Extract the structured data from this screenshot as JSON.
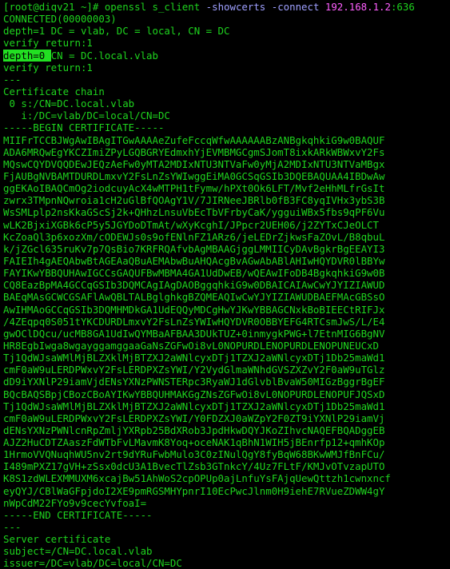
{
  "terminal": {
    "colors": {
      "background": "#000000",
      "text": "#1ed41e",
      "option_flag": "#9fa0ff",
      "ip_address": "#ff5fff",
      "selection_bg": "#22e022",
      "selection_fg": "#000000"
    },
    "prompt": "[root@diqv21 ~]# ",
    "command": {
      "program": "openssl s_client ",
      "flag1": "-showcerts",
      "space": " ",
      "flag2": "-connect",
      "space2": " ",
      "ip": "192.168.1.2",
      "port": ":636"
    },
    "before_cert": [
      "CONNECTED(00000003)",
      "depth=1 DC = vlab, DC = local, CN = DC",
      "verify return:1"
    ],
    "highlight_line": {
      "selected": "depth=0 ",
      "rest": "CN = DC.local.vlab"
    },
    "after_highlight": [
      "verify return:1",
      "---",
      "Certificate chain",
      " 0 s:/CN=DC.local.vlab",
      "   i:/DC=vlab/DC=local/CN=DC",
      "-----BEGIN CERTIFICATE-----",
      "MIIFrTCCBJWgAwIBAgITGwAAAAeZufeFccqWfwAAAAAABzANBgkqhkiG9w0BAQUF",
      "ADA6MRQwEgYKCZImiZPyLGQBGRYEdmxhYjEVMBMGCgmSJomT8ixkARkWBWxvY2Fs",
      "MQswCQYDVQQDEwJEQzAeFw0yMTA2MDIxNTU3NTVaFw0yMjA2MDIxNTU3NTVaMBgx",
      "FjAUBgNVBAMTDURDLmxvY2FsLnZsYWIwggEiMA0GCSqGSIb3DQEBAQUAA4IBDwAw",
      "ggEKAoIBAQCmOg2iodcuyAcX4wMTPH1tFymw/hPXt0Ok6LFT/Mvf2eHhMLfrGsIt",
      "zwrx3TMpnNQwroia1cH2uGlBfQOAgY1V/7JIRNeeJBRlb0fB3FC8yqIVHx3ybS3B",
      "WsSMLplp2nsKkaGScSj2k+QHhzLnsuVbEcTbVFrbyCaK/ygguiWBx5fbs9qPF6Vu",
      "wLK2BjxiXGBk6cP5y5JGYDoDTmAt/wXyKcghI/JPpcr2UEH06/j2ZYTxCJeOLCT",
      "KcZoaQl3p6xozXm/cODEWJs0s9ofENlnFZ1ARz6/jeLEDrZjkwsFaZOvL/B8qbuL",
      "k/jZGcl635ruKv7p7QsBio7KRFRQAfvbAgMBAAGjggLMMIICyDAvBgkrBgEEAYI3",
      "FAIEIh4gAEQAbwBtAGEAaQBuAEMAbwBuAHQAcgBvAGwAbABlAHIwHQYDVR0lBBYw",
      "FAYIKwYBBQUHAwIGCCsGAQUFBwMBMA4GA1UdDwEB/wQEAwIFoDB4BgkqhkiG9w0B",
      "CQ8EazBpMA4GCCqGSIb3DQMCAgIAgDAOBggqhkiG9w0DBAICAIAwCwYJYIZIAWUD",
      "BAEqMAsGCWCGSAFlAwQBLTALBglghkgBZQMEAQIwCwYJYIZIAWUDBAEFMAcGBSsO",
      "AwIHMAoGCCqGSIb3DQMHMDkGA1UdEQQyMDCgHwYJKwYBBAGCNxkBoBIEECtRIFJx",
      "/4ZEqpq0S051tYKCDURDLmxvY2FsLnZsYWIwHQYDVR0OBBYEFG4RTCsmJwS/L/E4",
      "gwOClDQcu/ucMB8GA1UdIwQYMBaAFBAA3DUkTUZ+0inmygkPWG+l7EtnMIG6BgNV",
      "HR8EgbIwga8wgayggamggaaGaNsZGFwOi8vL0NOPURDLENOPURDLENOPUNEUCxD",
      "Tj1QdWJsaWMlMjBLZXklMjBTZXJ2aWNlcyxDTj1TZXJ2aWNlcyxDTj1Db25maWd1",
      "cmF0aW9uLERDPWxvY2FsLERDPXZsYWI/Y2VydGlmaWNhdGVSZXZvY2F0aW9uTGlz",
      "dD9iYXNlP29iamVjdENsYXNzPWNSTERpc3RyaWJ1dGlvblBvaW50MIGzBggrBgEF",
      "BQcBAQSBpjCBozCBoAYIKwYBBQUHMAKGgZNsZGFwOi8vL0NOPURDLENOPUFJQSxD",
      "Tj1QdWJsaWMlMjBLZXklMjBTZXJ2aWNlcyxDTj1TZXJ2aWNlcyxDTj1Db25maWd1",
      "cmF0aW9uLERDPWxvY2FsLERDPXZsYWI/Y0FDZXJ0aWZpY2F0ZT9iYXNlP29iamVj",
      "dENsYXNzPWNlcnRpZmljYXRpb25BdXRob3JpdHkwDQYJKoZIhvcNAQEFBQADggEB",
      "AJZ2HuCDTZAaszFdWTbFvLMavmK8Yoq+oceNAK1qBhN1WIH5jBEnrfp12+qmhKOp",
      "1HrmoVVQNuqhWU5nv2rt9dYRuFwbMulo3C0zINulQgY8fyBqW68BKwWMJfBnFCu/",
      "I489mPXZ17gVH+zSsx0dcU3A1BvecTlZsb3GTnkcY/4Uz7FLtF/KMJvOTvzapUTO",
      "K8S1zdWLEXMMUXM6xcajBw51AhWoS2cpOPUp0ajLnfuYsFAjqUewQttzh1cwnxncf",
      "eyQYJ/CBlWaGFpjdoI2XE9pmRGSMHYpnrI10EcPwcJlnm0H9iehE7RVueZDWW4gY",
      "nWpCdM22FYo9v9cecYvfoaI=",
      "-----END CERTIFICATE-----",
      "---",
      "Server certificate",
      "subject=/CN=DC.local.vlab",
      "issuer=/DC=vlab/DC=local/CN=DC"
    ]
  }
}
